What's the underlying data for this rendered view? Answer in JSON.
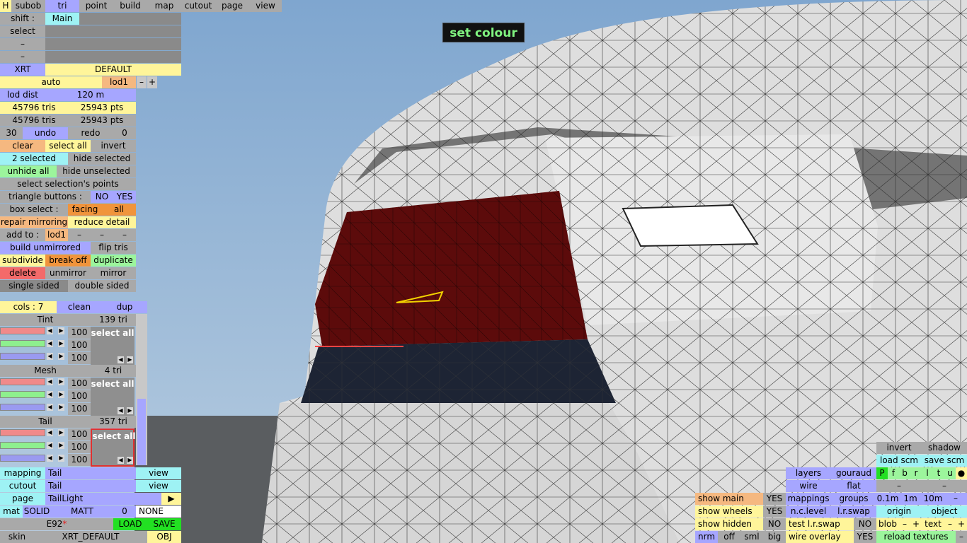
{
  "colors": {
    "blue": "#a6a6ff",
    "yellow": "#fff59a",
    "orange": "#f5b880",
    "cyan": "#9ef2f4",
    "green": "#9cf59c",
    "red": "#f46a6a",
    "grey": "#a9a9a9"
  },
  "tooltip": "set colour",
  "topbar": {
    "h": "H",
    "tabs": [
      "subob",
      "tri",
      "point",
      "build",
      "map",
      "cutout",
      "page",
      "view"
    ]
  },
  "shift": {
    "label": "shift :",
    "value": "Main"
  },
  "select_label": "select",
  "dash": "–",
  "xrt": {
    "label": "XRT",
    "value": "DEFAULT"
  },
  "lod": {
    "mode": "auto",
    "name": "lod1",
    "minus": "–",
    "plus": "+",
    "dist_label": "lod dist",
    "dist_value": "120 m"
  },
  "stats": {
    "tris1": "45796 tris",
    "pts1": "25943 pts",
    "tris2": "45796 tris",
    "pts2": "25943 pts"
  },
  "history": {
    "count": "30",
    "undo": "undo",
    "redo": "redo",
    "redo_count": "0"
  },
  "selection": {
    "clear": "clear",
    "select_all": "select all",
    "invert": "invert",
    "count": "2 selected",
    "hide_selected": "hide selected",
    "unhide_all": "unhide all",
    "hide_unselected": "hide unselected",
    "select_points": "select selection's points"
  },
  "triangle_buttons": {
    "label": "triangle buttons :",
    "no": "NO",
    "yes": "YES"
  },
  "box_select": {
    "label": "box select :",
    "facing": "facing",
    "all": "all"
  },
  "tools": {
    "repair": "repair mirroring",
    "reduce": "reduce detail",
    "add_to": "add to :",
    "add_lod": "lod1",
    "build_unmirrored": "build unmirrored",
    "flip_tris": "flip tris",
    "subdivide": "subdivide",
    "break_off": "break off",
    "duplicate": "duplicate",
    "delete": "delete",
    "unmirror": "unmirror",
    "mirror": "mirror",
    "single_sided": "single sided",
    "double_sided": "double sided"
  },
  "cols": {
    "label": "cols : 7",
    "clean": "clean",
    "dup": "dup"
  },
  "materials": [
    {
      "name": "Tint",
      "tris": "139 tri",
      "r": "100",
      "g": "100",
      "b": "100",
      "select_all": "select all"
    },
    {
      "name": "Mesh",
      "tris": "4 tri",
      "r": "100",
      "g": "100",
      "b": "100",
      "select_all": "select all"
    },
    {
      "name": "Tail",
      "tris": "357 tri",
      "r": "100",
      "g": "100",
      "b": "100",
      "select_all": "select all"
    }
  ],
  "bottom_left": {
    "mapping_label": "mapping",
    "mapping_value": "Tail",
    "view": "view",
    "cutout_label": "cutout",
    "cutout_value": "Tail",
    "page_label": "page",
    "page_value": "TailLight",
    "page_arrow": "▶",
    "mat": "mat",
    "solid": "SOLID",
    "matt": "MATT",
    "zero": "0",
    "none": "NONE",
    "file": "E92",
    "load": "LOAD",
    "save": "SAVE",
    "skin": "skin",
    "skin_value": "XRT_DEFAULT",
    "obj": "OBJ"
  },
  "right_panel": {
    "invert": "invert",
    "shadow": "shadow",
    "load_scm": "load scm",
    "save_scm": "save scm",
    "layers": "layers",
    "gouraud": "gouraud",
    "letters": [
      "P",
      "f",
      "b",
      "r",
      "l",
      "t",
      "u",
      "●"
    ],
    "wire": "wire",
    "flat": "flat",
    "dash": "–",
    "mappings": "mappings",
    "groups": "groups",
    "m01": "0.1m",
    "m1": "1m",
    "m10": "10m",
    "n_c_level": "n.c.level",
    "l_r_swap": "l.r.swap",
    "origin": "origin",
    "object": "object",
    "test_swap": "test l.r.swap",
    "no": "NO",
    "blob": "blob",
    "text": "text",
    "minus": "–",
    "plus": "+",
    "wire_overlay": "wire overlay",
    "yes": "YES",
    "reload": "reload textures",
    "show_main": "show main",
    "show_wheels": "show wheels",
    "show_hidden": "show hidden",
    "nrm": "nrm",
    "off": "off",
    "sml": "sml",
    "big": "big"
  }
}
